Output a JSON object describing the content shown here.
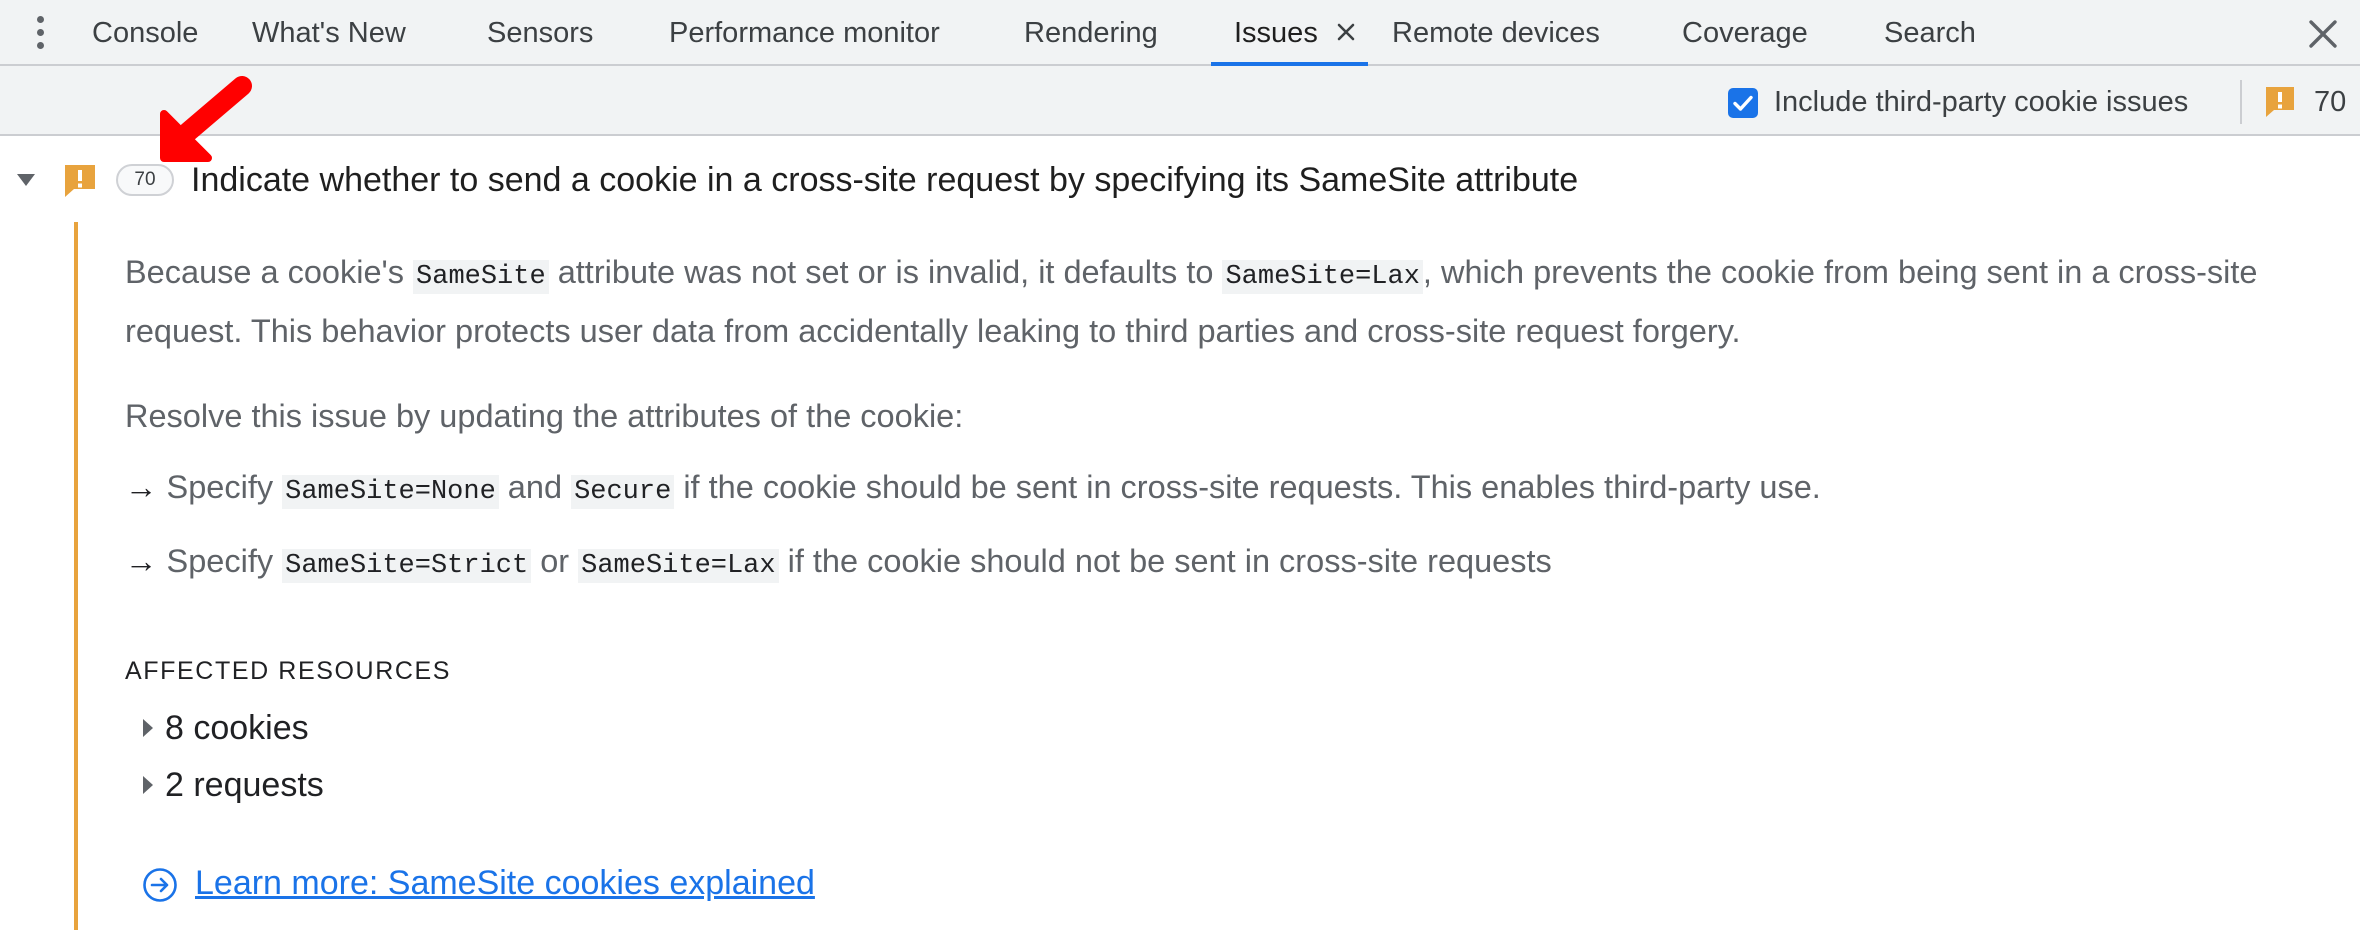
{
  "tabs": [
    {
      "label": "Console",
      "active": false
    },
    {
      "label": "What's New",
      "active": false
    },
    {
      "label": "Sensors",
      "active": false
    },
    {
      "label": "Performance monitor",
      "active": false
    },
    {
      "label": "Rendering",
      "active": false
    },
    {
      "label": "Issues",
      "active": true,
      "closable": true
    },
    {
      "label": "Remote devices",
      "active": false
    },
    {
      "label": "Coverage",
      "active": false
    },
    {
      "label": "Search",
      "active": false
    }
  ],
  "toolbar": {
    "checkbox_label": "Include third-party cookie issues",
    "checkbox_checked": true,
    "issue_count": "70"
  },
  "issue": {
    "count": "70",
    "title": "Indicate whether to send a cookie in a cross-site request by specifying its SameSite attribute",
    "description": {
      "t1": "Because a cookie's ",
      "c1": "SameSite",
      "t2": " attribute was not set or is invalid, it defaults to ",
      "c2": "SameSite=Lax",
      "t3": ", which prevents the cookie from being sent in a cross-site request. This behavior protects user data from accidentally leaking to third parties and cross-site request forgery."
    },
    "resolve": "Resolve this issue by updating the attributes of the cookie:",
    "bullet1": {
      "arrow": "→",
      "t1": " Specify ",
      "c1": "SameSite=None",
      "t2": " and ",
      "c2": "Secure",
      "t3": " if the cookie should be sent in cross-site requests. This enables third-party use."
    },
    "bullet2": {
      "arrow": "→",
      "t1": " Specify ",
      "c1": "SameSite=Strict",
      "t2": " or ",
      "c2": "SameSite=Lax",
      "t3": " if the cookie should not be sent in cross-site requests"
    },
    "affected_heading": "AFFECTED RESOURCES",
    "resources": [
      {
        "label": "8 cookies"
      },
      {
        "label": "2 requests"
      }
    ],
    "learn_more": "Learn more: SameSite cookies explained"
  },
  "colors": {
    "accent": "#1a73e8",
    "warning": "#e8a33d",
    "annotation": "#ff0000"
  },
  "icons": [
    "more-vert-icon",
    "close-icon",
    "warning-icon",
    "triangle-down-icon",
    "triangle-right-icon",
    "arrow-circle-right-icon",
    "red-arrow-annotation"
  ]
}
